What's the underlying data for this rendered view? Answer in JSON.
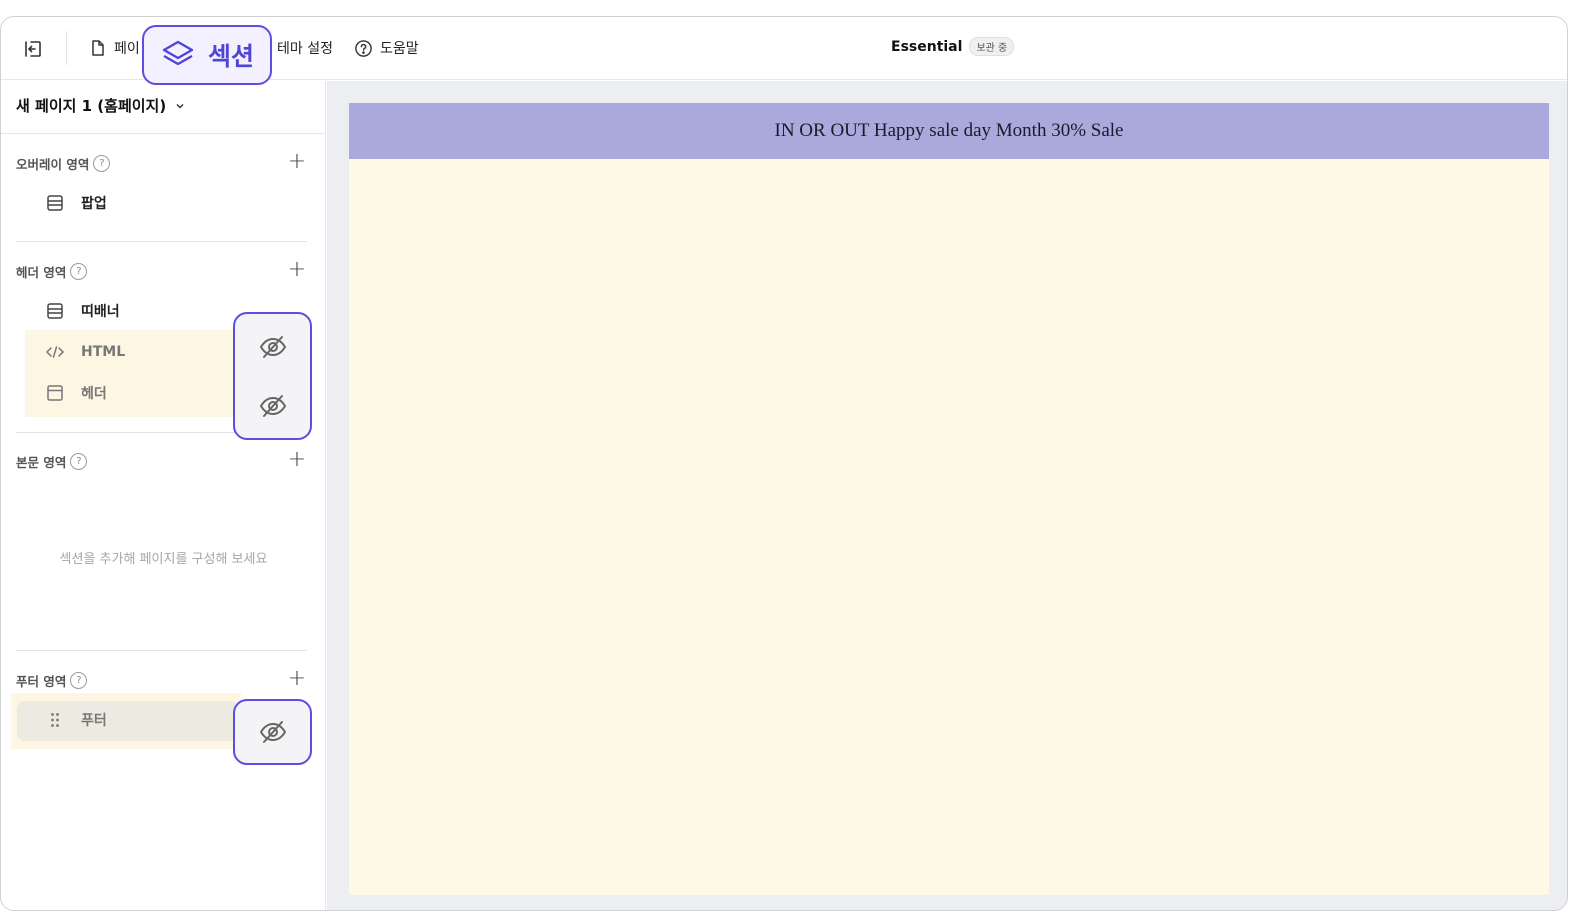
{
  "topbar": {
    "tabs": [
      {
        "label": "페이"
      },
      {
        "label": "테마 설정"
      },
      {
        "label": "도움말"
      }
    ],
    "section_callout_label": "섹션",
    "site_title": "Essential",
    "status_badge": "보관 중"
  },
  "sidebar": {
    "page_selector": "새 페이지 1 (홈페이지)",
    "overlay_zone": {
      "title": "오버레이 영역",
      "items": [
        {
          "label": "팝업"
        }
      ]
    },
    "header_zone": {
      "title": "헤더 영역",
      "items": [
        {
          "label": "띠배너"
        },
        {
          "label": "HTML"
        },
        {
          "label": "헤더"
        }
      ]
    },
    "body_zone": {
      "title": "본문 영역",
      "empty_message": "섹션을 추가해 페이지를 구성해 보세요"
    },
    "footer_zone": {
      "title": "푸터 영역",
      "items": [
        {
          "label": "푸터"
        }
      ]
    }
  },
  "preview": {
    "banner_text": "IN OR OUT Happy sale day Month 30% Sale"
  },
  "colors": {
    "accent": "#5a4fe0",
    "banner_bg": "#aaa9db",
    "canvas_bg": "#fef8e6",
    "highlight_bg": "#fdf6e2"
  }
}
